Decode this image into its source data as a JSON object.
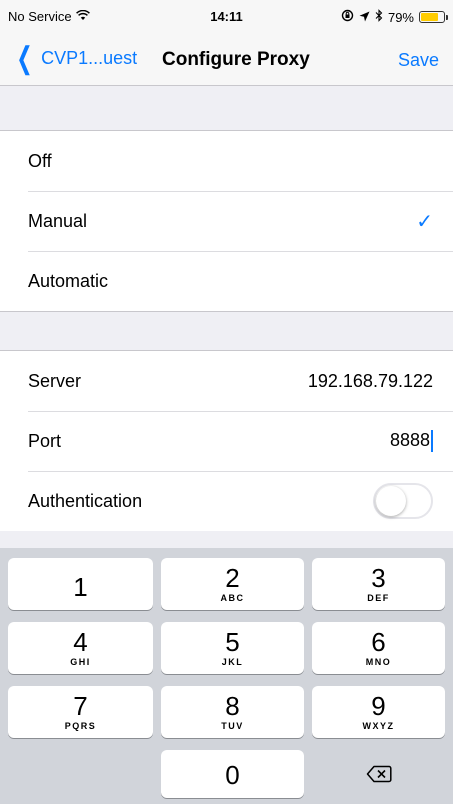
{
  "status_bar": {
    "carrier": "No Service",
    "time": "14:11",
    "battery_percent": "79%",
    "battery_level": 0.79,
    "icons": [
      "wifi-icon",
      "lock-rotation-icon",
      "location-icon",
      "bluetooth-icon",
      "battery-icon"
    ]
  },
  "nav": {
    "back_label": "CVP1...uest",
    "title": "Configure Proxy",
    "save_label": "Save"
  },
  "proxy_modes": [
    {
      "label": "Off",
      "selected": false
    },
    {
      "label": "Manual",
      "selected": true
    },
    {
      "label": "Automatic",
      "selected": false
    }
  ],
  "settings": {
    "server_label": "Server",
    "server_value": "192.168.79.122",
    "port_label": "Port",
    "port_value": "8888",
    "auth_label": "Authentication",
    "auth_enabled": false
  },
  "keypad": {
    "keys": [
      {
        "num": "1",
        "letters": ""
      },
      {
        "num": "2",
        "letters": "ABC"
      },
      {
        "num": "3",
        "letters": "DEF"
      },
      {
        "num": "4",
        "letters": "GHI"
      },
      {
        "num": "5",
        "letters": "JKL"
      },
      {
        "num": "6",
        "letters": "MNO"
      },
      {
        "num": "7",
        "letters": "PQRS"
      },
      {
        "num": "8",
        "letters": "TUV"
      },
      {
        "num": "9",
        "letters": "WXYZ"
      },
      {
        "num": "0",
        "letters": ""
      }
    ]
  },
  "colors": {
    "accent": "#0a7aff",
    "battery": "#ffcc00",
    "background": "#efeff4"
  }
}
